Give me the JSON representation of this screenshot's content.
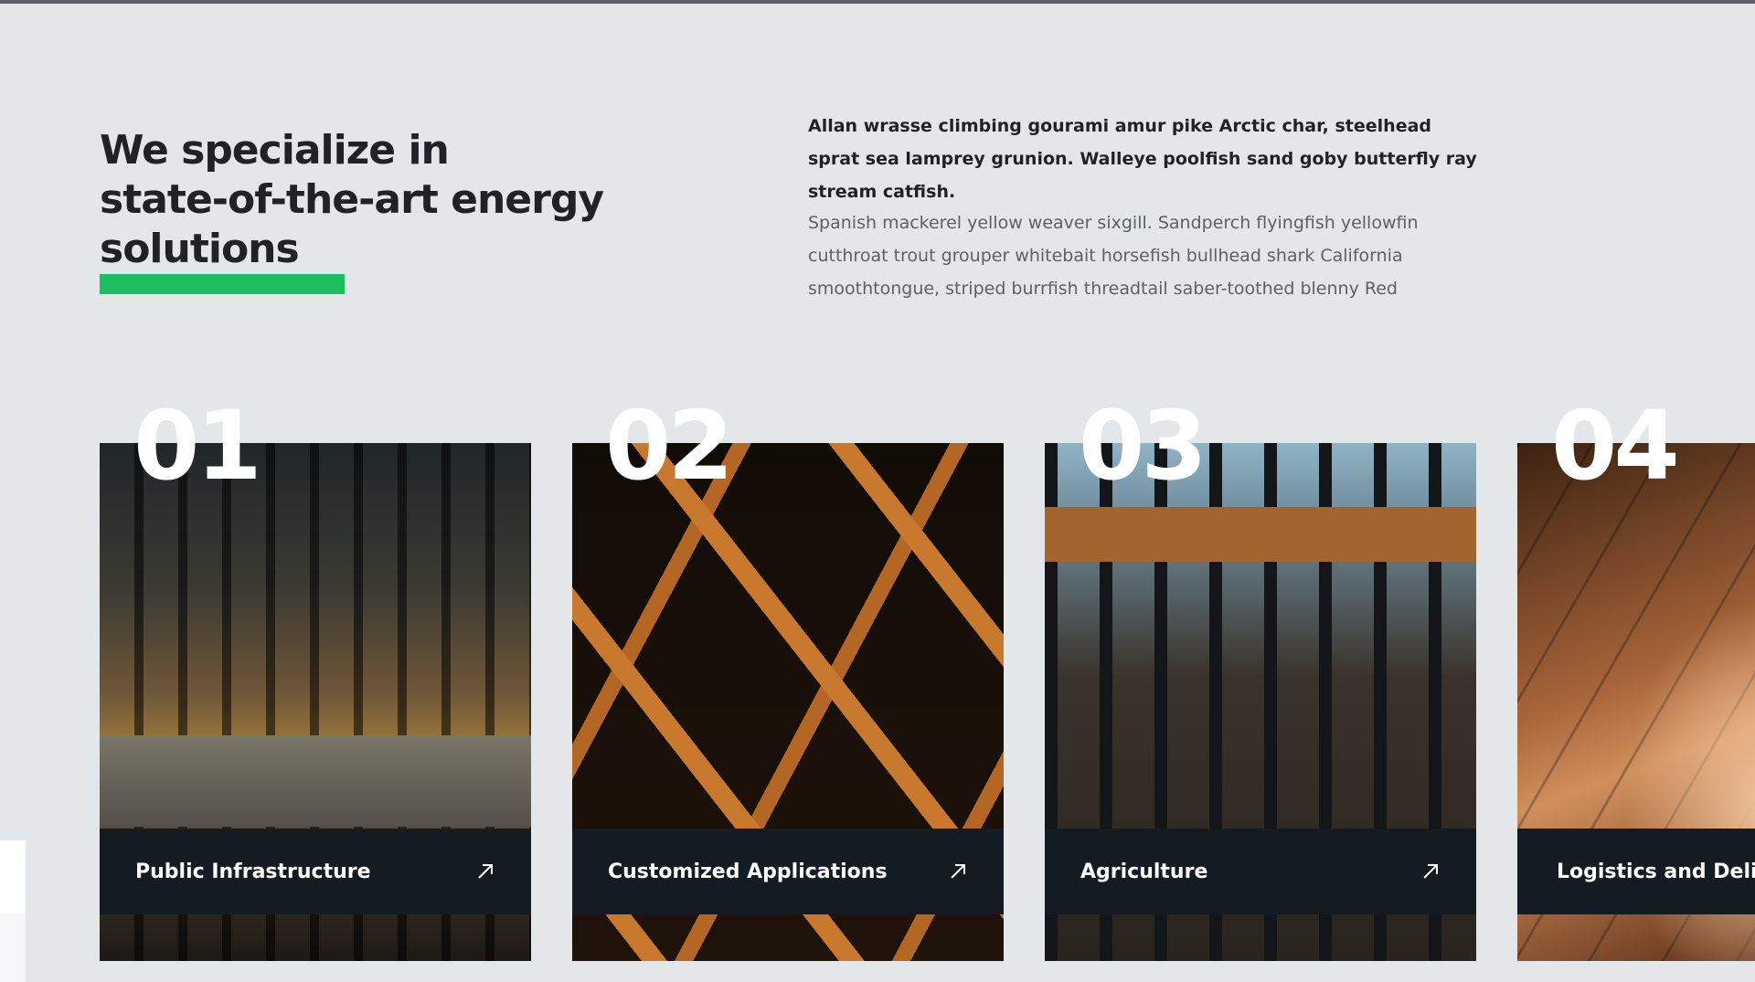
{
  "section": {
    "title_line1": "We specialize in",
    "title_line2": "state-of-the-art energy solutions",
    "lead": "Allan wrasse climbing gourami amur pike Arctic char, steelhead sprat sea lamprey grunion. Walleye poolfish sand goby butterfly ray stream catfish.",
    "body": "Spanish mackerel yellow weaver sixgill. Sandperch flyingfish yellowfin cutthroat trout grouper whitebait horsefish bullhead shark California smoothtongue, striped burrfish threadtail saber-toothed blenny Red"
  },
  "cards": [
    {
      "number": "01",
      "label": "Public Infrastructure",
      "icon": "arrow-up-right-icon"
    },
    {
      "number": "02",
      "label": "Customized Applications",
      "icon": "arrow-up-right-icon"
    },
    {
      "number": "03",
      "label": "Agriculture",
      "icon": "arrow-up-right-icon"
    },
    {
      "number": "04",
      "label": "Logistics and Deliver",
      "icon": "arrow-up-right-icon"
    }
  ],
  "colors": {
    "background": "#e3e7ea",
    "accent": "#1bbf60",
    "card_footer": "#151b23",
    "text_dark": "#1f2328",
    "text_muted": "#5b6168"
  }
}
